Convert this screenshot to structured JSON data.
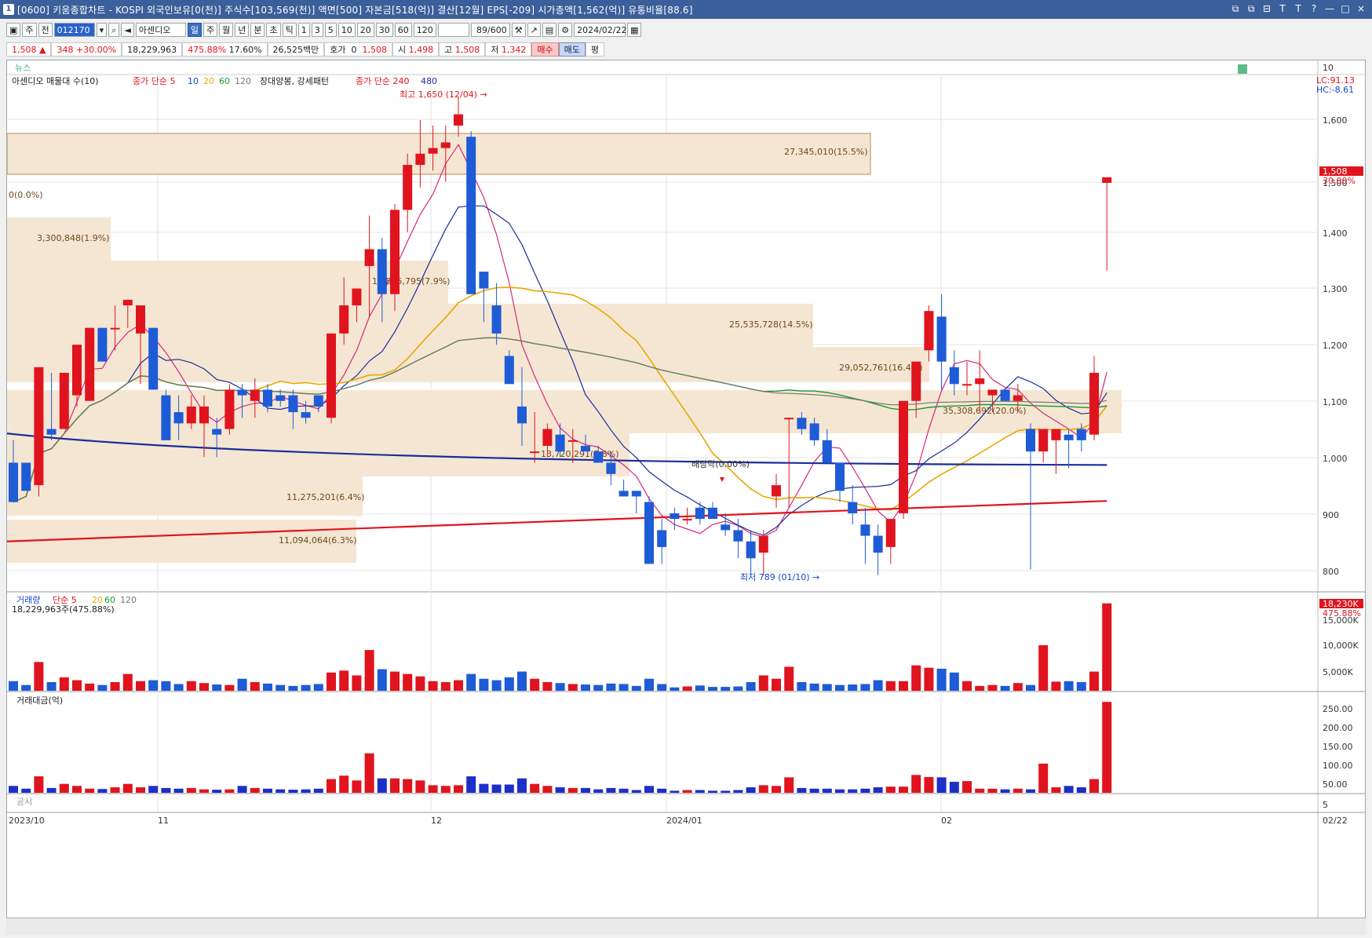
{
  "window": {
    "number": "1",
    "title": "[0600] 키움종합차트 - KOSPI 외국인보유[0(천)] 주식수[103,569(천)] 액면[500] 자본금[518(억)] 결산[12월] EPS[-209] 시가총액[1,562(억)] 유통비율[88.6]",
    "buttons": [
      "⧉",
      "⧉",
      "⊟",
      "T",
      "T",
      "?",
      "—",
      "□",
      "×"
    ]
  },
  "toolbar": {
    "type_labels": [
      "주",
      "전"
    ],
    "code": "012170",
    "name": "아센디오",
    "periods": [
      "일",
      "주",
      "월",
      "년",
      "분",
      "초",
      "틱"
    ],
    "intervals": [
      "1",
      "3",
      "5",
      "10",
      "20",
      "30",
      "60",
      "120"
    ],
    "count": "89/600",
    "date": "2024/02/22"
  },
  "quote": {
    "price": "1,508",
    "arrow": "▲",
    "change": "348",
    "change_pct": "+30.00%",
    "volume": "18,229,963",
    "vol_ratio": "475.88%",
    "turnover": "17.60%",
    "amount": "26,525백만",
    "hoga_label": "호가",
    "hoga_val": "0",
    "hoga_price": "1,508",
    "open_label": "시",
    "open": "1,498",
    "high_label": "고",
    "high": "1,508",
    "low_label": "저",
    "low": "1,342",
    "buy": "매수",
    "sell": "매도",
    "avg": "평"
  },
  "panels": {
    "news_label": "뉴스",
    "news_axis": "10",
    "price_legend": [
      "아센디오 매물대 수(10)",
      "종가 단순 5",
      "10",
      "20",
      "60",
      "120",
      "장대양봉, 강세패턴",
      "종가 단순 240",
      "480"
    ],
    "lc": "LC:91.13",
    "hc": "HC:-8.61",
    "price_axis": [
      "1,600",
      "1,500",
      "1,400",
      "1,300",
      "1,200",
      "1,100",
      "1,000",
      "900",
      "800"
    ],
    "last_price_tag": "1,508",
    "last_pct_tag": "30.00%",
    "high_note": "최고 1,650 (12/04) →",
    "low_note": "최저 789 (01/10) →",
    "dividend_note": "배당락(0.00%)",
    "volume_legend": [
      "거래량",
      "단순 5",
      "20",
      "60",
      "120"
    ],
    "volume_value": "18,229,963주(475.88%)",
    "volume_axis": [
      "15,000K",
      "10,000K",
      "5,000K"
    ],
    "volume_tag": "18,230K",
    "volume_tag_pct": "475.88%",
    "amount_label": "거래대금(억)",
    "amount_axis": [
      "250.00",
      "200.00",
      "150.00",
      "100.00",
      "50.00"
    ],
    "disclosure_label": "공시",
    "disclosure_axis": "5",
    "x_labels": [
      "2023/10",
      "11",
      "12",
      "2024/01",
      "02",
      "02/22"
    ]
  },
  "profile": [
    {
      "label": "27,345,010(15.5%)"
    },
    {
      "label": "0(0.0%)"
    },
    {
      "label": "3,300,848(1.9%)"
    },
    {
      "label": "13,895,795(7.9%)"
    },
    {
      "label": "25,535,728(14.5%)"
    },
    {
      "label": "29,052,761(16.4%)"
    },
    {
      "label": "35,308,692(20.0%)"
    },
    {
      "label": "13,720,291(7.8%)"
    },
    {
      "label": "11,275,201(6.4%)"
    },
    {
      "label": "11,094,064(6.3%)"
    }
  ],
  "chart_data": {
    "type": "candlestick",
    "ylim": [
      780,
      1660
    ],
    "candles": [
      [
        1000,
        1040,
        940,
        930
      ],
      [
        1000,
        1000,
        960,
        950
      ],
      [
        960,
        1170,
        940,
        1170
      ],
      [
        1060,
        1160,
        1040,
        1050
      ],
      [
        1060,
        1160,
        1060,
        1160
      ],
      [
        1120,
        1210,
        1100,
        1210
      ],
      [
        1110,
        1240,
        1110,
        1240
      ],
      [
        1240,
        1240,
        1180,
        1180
      ],
      [
        1240,
        1280,
        1200,
        1240
      ],
      [
        1280,
        1290,
        1240,
        1290
      ],
      [
        1230,
        1280,
        1140,
        1280
      ],
      [
        1240,
        1240,
        1130,
        1130
      ],
      [
        1120,
        1130,
        1040,
        1040
      ],
      [
        1090,
        1120,
        1040,
        1070
      ],
      [
        1070,
        1120,
        1060,
        1100
      ],
      [
        1070,
        1120,
        1010,
        1100
      ],
      [
        1060,
        1080,
        1010,
        1050
      ],
      [
        1060,
        1140,
        1050,
        1130
      ],
      [
        1130,
        1140,
        1080,
        1120
      ],
      [
        1110,
        1150,
        1080,
        1130
      ],
      [
        1130,
        1140,
        1090,
        1100
      ],
      [
        1120,
        1130,
        1100,
        1110
      ],
      [
        1120,
        1130,
        1060,
        1090
      ],
      [
        1090,
        1110,
        1070,
        1080
      ],
      [
        1120,
        1120,
        1090,
        1100
      ],
      [
        1080,
        1230,
        1070,
        1230
      ],
      [
        1230,
        1330,
        1210,
        1280
      ],
      [
        1280,
        1310,
        1250,
        1310
      ],
      [
        1350,
        1440,
        1260,
        1380
      ],
      [
        1380,
        1400,
        1250,
        1300
      ],
      [
        1300,
        1460,
        1270,
        1450
      ],
      [
        1450,
        1550,
        1410,
        1530
      ],
      [
        1530,
        1610,
        1490,
        1550
      ],
      [
        1550,
        1600,
        1520,
        1560
      ],
      [
        1560,
        1600,
        1500,
        1570
      ],
      [
        1600,
        1650,
        1580,
        1620
      ],
      [
        1580,
        1590,
        1300,
        1300
      ],
      [
        1340,
        1340,
        1250,
        1310
      ],
      [
        1280,
        1320,
        1210,
        1230
      ],
      [
        1190,
        1200,
        1150,
        1140
      ],
      [
        1100,
        1170,
        1030,
        1070
      ],
      [
        1020,
        1090,
        1000,
        1020
      ],
      [
        1030,
        1070,
        1010,
        1060
      ],
      [
        1050,
        1070,
        1010,
        1020
      ],
      [
        1040,
        1060,
        1000,
        1040
      ],
      [
        1030,
        1050,
        1020,
        1020
      ],
      [
        1020,
        1030,
        1010,
        1000
      ],
      [
        1000,
        1020,
        960,
        980
      ],
      [
        950,
        970,
        940,
        940
      ],
      [
        950,
        950,
        910,
        940
      ],
      [
        930,
        940,
        820,
        820
      ],
      [
        880,
        900,
        820,
        850
      ],
      [
        910,
        920,
        880,
        900
      ],
      [
        900,
        920,
        890,
        900
      ],
      [
        920,
        930,
        890,
        900
      ],
      [
        920,
        930,
        910,
        900
      ],
      [
        890,
        910,
        870,
        880
      ],
      [
        880,
        900,
        830,
        860
      ],
      [
        860,
        880,
        800,
        830
      ],
      [
        840,
        880,
        800,
        870
      ],
      [
        940,
        980,
        920,
        960
      ],
      [
        1080,
        1080,
        920,
        1080
      ],
      [
        1080,
        1090,
        1050,
        1060
      ],
      [
        1070,
        1080,
        1030,
        1040
      ],
      [
        1040,
        1060,
        1000,
        1000
      ],
      [
        1000,
        1000,
        930,
        950
      ],
      [
        930,
        960,
        890,
        910
      ],
      [
        890,
        920,
        820,
        870
      ],
      [
        870,
        890,
        800,
        840
      ],
      [
        850,
        890,
        820,
        900
      ],
      [
        910,
        1100,
        900,
        1110
      ],
      [
        1110,
        1130,
        1080,
        1180
      ],
      [
        1200,
        1280,
        1180,
        1270
      ],
      [
        1260,
        1300,
        1130,
        1180
      ],
      [
        1170,
        1200,
        1120,
        1140
      ],
      [
        1140,
        1180,
        1120,
        1140
      ],
      [
        1140,
        1200,
        1090,
        1150
      ],
      [
        1120,
        1130,
        1090,
        1130
      ],
      [
        1130,
        1130,
        1110,
        1110
      ],
      [
        1110,
        1140,
        1090,
        1120
      ],
      [
        1060,
        1070,
        810,
        1020
      ],
      [
        1020,
        1060,
        1000,
        1060
      ],
      [
        1040,
        1060,
        980,
        1060
      ],
      [
        1050,
        1060,
        990,
        1040
      ],
      [
        1060,
        1070,
        1020,
        1040
      ],
      [
        1050,
        1190,
        1040,
        1160
      ],
      [
        1498,
        1508,
        1342,
        1508
      ]
    ],
    "volume_k": [
      2000,
      1200,
      6000,
      1800,
      2800,
      2200,
      1500,
      1200,
      1800,
      3500,
      2000,
      2200,
      2000,
      1400,
      2000,
      1600,
      1300,
      1200,
      2500,
      1800,
      1500,
      1200,
      1000,
      1200,
      1400,
      3800,
      4200,
      3200,
      8500,
      4500,
      4000,
      3500,
      3000,
      2000,
      1800,
      2200,
      3500,
      2500,
      2200,
      2800,
      4000,
      2500,
      1800,
      1600,
      1400,
      1300,
      1200,
      1500,
      1400,
      1000,
      2500,
      1400,
      700,
      900,
      1100,
      800,
      800,
      900,
      1800,
      3200,
      2500,
      5000,
      1800,
      1500,
      1400,
      1200,
      1300,
      1400,
      2200,
      2000,
      2000,
      5300,
      4800,
      4600,
      3800,
      2000,
      1000,
      1200,
      1000,
      1600,
      1200,
      9500,
      1900,
      2000,
      1800,
      4000,
      18230
    ],
    "amount_100m": [
      20,
      12,
      48,
      14,
      26,
      20,
      12,
      11,
      16,
      26,
      16,
      20,
      14,
      12,
      14,
      10,
      9,
      10,
      20,
      14,
      12,
      10,
      9,
      10,
      12,
      40,
      50,
      36,
      115,
      42,
      42,
      40,
      36,
      22,
      20,
      22,
      48,
      26,
      24,
      24,
      42,
      26,
      20,
      16,
      14,
      14,
      10,
      14,
      12,
      8,
      20,
      12,
      6,
      8,
      8,
      6,
      6,
      8,
      16,
      22,
      20,
      45,
      14,
      12,
      12,
      10,
      10,
      12,
      16,
      18,
      18,
      52,
      46,
      45,
      32,
      34,
      12,
      12,
      10,
      12,
      10,
      85,
      16,
      20,
      16,
      40,
      265
    ]
  }
}
